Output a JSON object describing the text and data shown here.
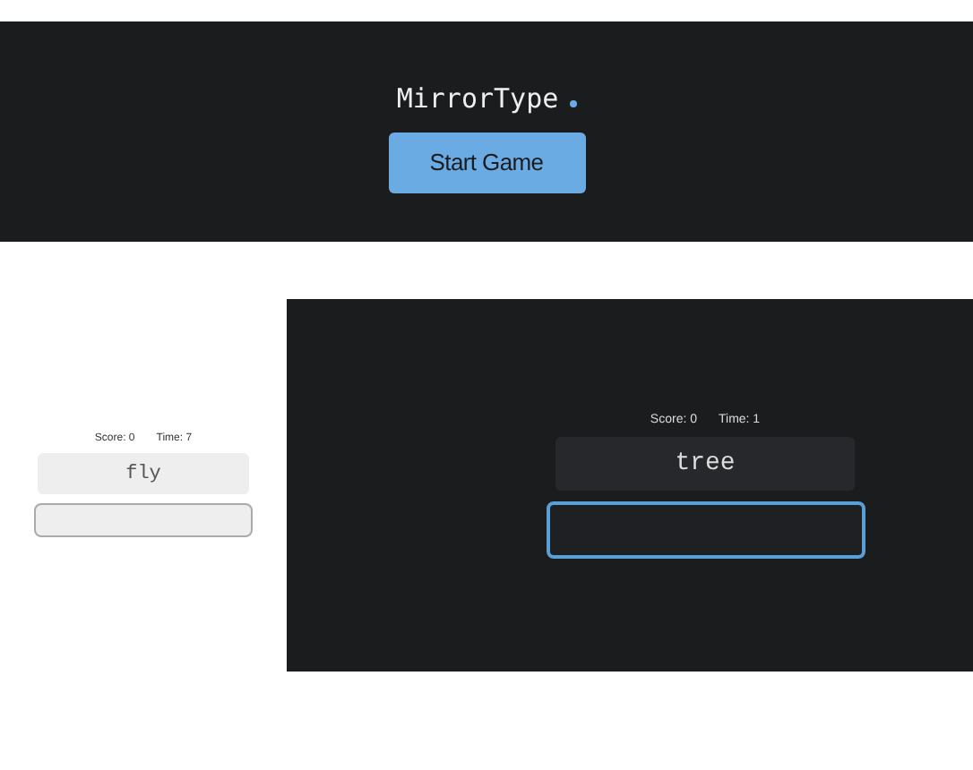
{
  "header": {
    "title": "MirrorType",
    "button": "Start Game"
  },
  "previews": [
    {
      "kind": "light",
      "score": "Score: 0",
      "time": "Time: 7",
      "word": "fly",
      "focused": false
    },
    {
      "kind": "dark",
      "score": "Score: 0",
      "time": "Time: 1",
      "word": "tree",
      "focused": true
    }
  ]
}
